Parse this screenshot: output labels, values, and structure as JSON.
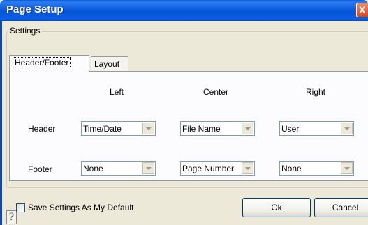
{
  "window": {
    "title": "Page Setup",
    "close_glyph": "X"
  },
  "settings": {
    "group_label": "Settings",
    "tabs": [
      {
        "label": "Header/Footer",
        "active": true
      },
      {
        "label": "Layout",
        "active": false
      }
    ],
    "columns": [
      "Left",
      "Center",
      "Right"
    ],
    "rows": [
      {
        "label": "Header",
        "values": [
          "Time/Date",
          "File Name",
          "User"
        ]
      },
      {
        "label": "Footer",
        "values": [
          "None",
          "Page Number",
          "None"
        ]
      }
    ]
  },
  "footer": {
    "help_glyph": "?",
    "save_default_label": "Save Settings As My Default",
    "save_default_checked": false,
    "ok_label": "Ok",
    "cancel_label": "Cancel"
  },
  "colors": {
    "titlebar": "#0455d4",
    "dialog_bg": "#ece9d8",
    "tab_panel": "#fcfcfe"
  }
}
